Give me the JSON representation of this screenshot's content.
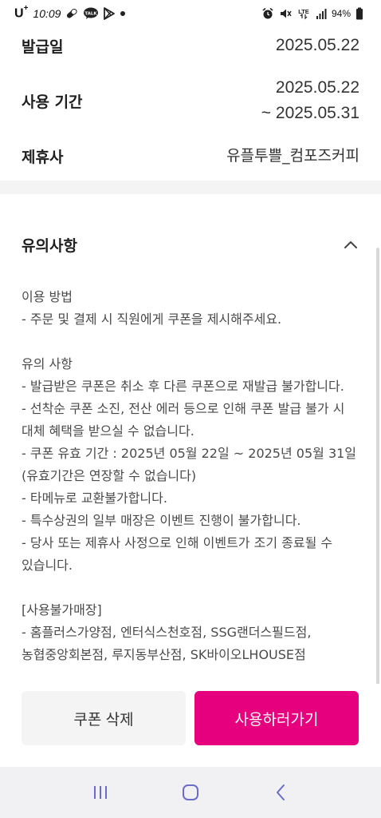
{
  "status_bar": {
    "carrier": "U",
    "carrier_sup": "+",
    "time": "10:09",
    "lte": "LTE",
    "battery_percent": "94%"
  },
  "coupon_info": {
    "issue_date_label": "발급일",
    "issue_date": "2025.05.22",
    "period_label": "사용 기간",
    "period_start": "2025.05.22",
    "period_end": "~ 2025.05.31",
    "partner_label": "제휴사",
    "partner": "유플투쁠_컴포즈커피"
  },
  "notice": {
    "title": "유의사항",
    "lines": [
      "이용 방법",
      "- 주문 및 결제 시 직원에게 쿠폰을 제시해주세요.",
      "",
      "유의 사항",
      "- 발급받은 쿠폰은 취소 후 다른 쿠폰으로 재발급 불가합니다.",
      "- 선착순 쿠폰 소진, 전산 에러 등으로 인해 쿠폰 발급 불가 시 대체 혜택을 받으실 수 없습니다.",
      "- 쿠폰 유효 기간 : 2025년 05월 22일 ~ 2025년 05월 31일 (유효기간은 연장할 수 없습니다)",
      "- 타메뉴로 교환불가합니다.",
      "- 특수상권의 일부 매장은 이벤트 진행이 불가합니다.",
      "- 당사 또는 제휴사 사정으로 인해 이벤트가 조기 종료될 수 있습니다.",
      "",
      "[사용불가매장]",
      "- 홈플러스가양점, 엔터식스천호점, SSG랜더스필드점, 농협중앙회본점, 루지동부산점, SK바이오LHOUSE점"
    ]
  },
  "actions": {
    "delete_label": "쿠폰 삭제",
    "use_label": "사용하러가기"
  },
  "colors": {
    "accent": "#e6007e",
    "secondary_button": "#f4f4f5",
    "section_divider": "#f4f4f5",
    "nav_bar": "#f1f1f3"
  },
  "icons": {
    "chevron": "chevron-up-icon",
    "nav_recent": "recent-apps-icon",
    "nav_home": "home-icon",
    "nav_back": "back-icon"
  }
}
